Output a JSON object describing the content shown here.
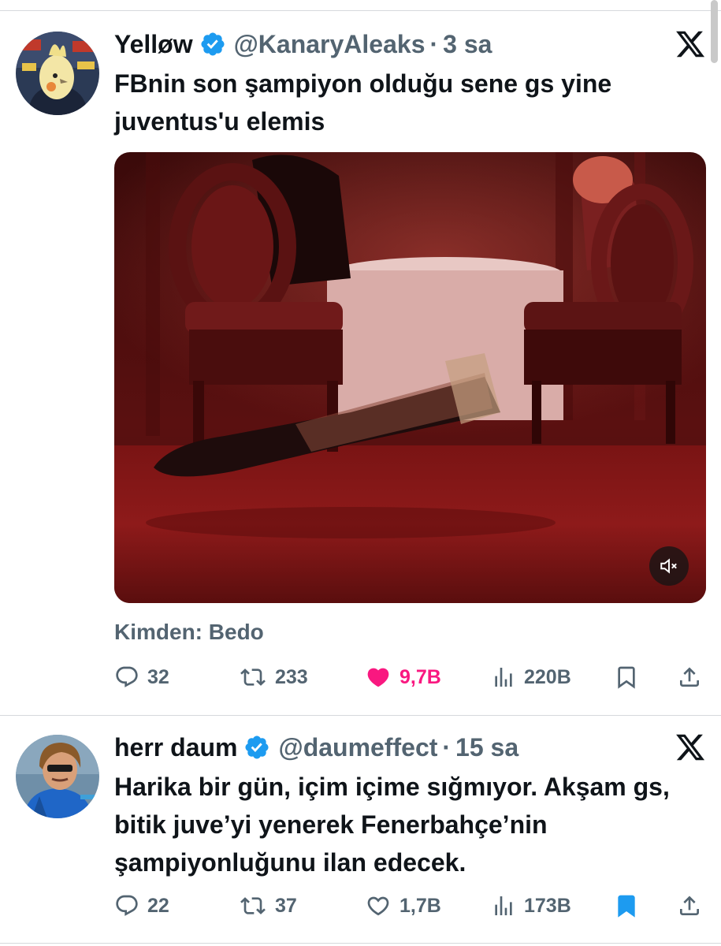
{
  "tweets": [
    {
      "author_name": "Yelløw",
      "handle": "@KanaryAleaks",
      "separator": "·",
      "time": "3 sa",
      "text": "FBnin son şampiyon olduğu sene gs yine juventus'u elemis",
      "media_source": "Kimden: Bedo",
      "media_icon": "mute-icon",
      "actions": {
        "replies": "32",
        "reposts": "233",
        "likes": "9,7B",
        "views": "220B"
      },
      "liked": true,
      "bookmarked": false
    },
    {
      "author_name": "herr daum",
      "handle": "@daumeffect",
      "separator": "·",
      "time": "15 sa",
      "text": "Harika bir gün, içim içime sığmıyor. Akşam gs, bitik juve’yi yenerek Fenerbahçe’nin şampiyonluğunu ilan edecek.",
      "actions": {
        "replies": "22",
        "reposts": "37",
        "likes": "1,7B",
        "views": "173B"
      },
      "liked": false,
      "bookmarked": true
    }
  ],
  "colors": {
    "text": "#0f1419",
    "secondary": "#536471",
    "verified": "#1d9bf0",
    "like": "#f91880",
    "bookmark": "#1d9bf0"
  }
}
